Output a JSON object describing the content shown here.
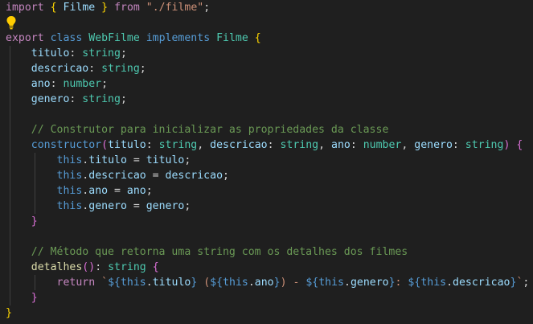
{
  "theme": {
    "background": "#1f1f1f",
    "colors": {
      "kw": "#c586c0",
      "st": "#569cd6",
      "cls": "#4ec9b0",
      "var": "#9cdcfe",
      "fn": "#dcdcaa",
      "str": "#ce9178",
      "cmt": "#6a9955",
      "pun": "#d4d4d4",
      "br1": "#ffd700",
      "br2": "#da70d6",
      "br3": "#179fff"
    }
  },
  "editor": {
    "lightbulb_icon": "lightbulb-icon",
    "lines": [
      [
        [
          "import",
          "kw"
        ],
        [
          " ",
          "pun"
        ],
        [
          "{",
          "br1"
        ],
        [
          " ",
          "pun"
        ],
        [
          "Filme",
          "var"
        ],
        [
          " ",
          "pun"
        ],
        [
          "}",
          "br1"
        ],
        [
          " ",
          "pun"
        ],
        [
          "from",
          "kw"
        ],
        [
          " ",
          "pun"
        ],
        [
          "\"./filme\"",
          "str"
        ],
        [
          ";",
          "pun"
        ]
      ],
      [],
      [
        [
          "export",
          "kw"
        ],
        [
          " ",
          "pun"
        ],
        [
          "class",
          "st"
        ],
        [
          " ",
          "pun"
        ],
        [
          "WebFilme",
          "cls"
        ],
        [
          " ",
          "pun"
        ],
        [
          "implements",
          "st"
        ],
        [
          " ",
          "pun"
        ],
        [
          "Filme",
          "cls"
        ],
        [
          " ",
          "pun"
        ],
        [
          "{",
          "br1"
        ]
      ],
      [
        [
          "    ",
          "pun"
        ],
        [
          "titulo",
          "var"
        ],
        [
          ": ",
          "pun"
        ],
        [
          "string",
          "cls"
        ],
        [
          ";",
          "pun"
        ]
      ],
      [
        [
          "    ",
          "pun"
        ],
        [
          "descricao",
          "var"
        ],
        [
          ": ",
          "pun"
        ],
        [
          "string",
          "cls"
        ],
        [
          ";",
          "pun"
        ]
      ],
      [
        [
          "    ",
          "pun"
        ],
        [
          "ano",
          "var"
        ],
        [
          ": ",
          "pun"
        ],
        [
          "number",
          "cls"
        ],
        [
          ";",
          "pun"
        ]
      ],
      [
        [
          "    ",
          "pun"
        ],
        [
          "genero",
          "var"
        ],
        [
          ": ",
          "pun"
        ],
        [
          "string",
          "cls"
        ],
        [
          ";",
          "pun"
        ]
      ],
      [],
      [
        [
          "    ",
          "pun"
        ],
        [
          "// Construtor para inicializar as propriedades da classe",
          "cmt"
        ]
      ],
      [
        [
          "    ",
          "pun"
        ],
        [
          "constructor",
          "st"
        ],
        [
          "(",
          "br2"
        ],
        [
          "titulo",
          "var"
        ],
        [
          ": ",
          "pun"
        ],
        [
          "string",
          "cls"
        ],
        [
          ", ",
          "pun"
        ],
        [
          "descricao",
          "var"
        ],
        [
          ": ",
          "pun"
        ],
        [
          "string",
          "cls"
        ],
        [
          ", ",
          "pun"
        ],
        [
          "ano",
          "var"
        ],
        [
          ": ",
          "pun"
        ],
        [
          "number",
          "cls"
        ],
        [
          ", ",
          "pun"
        ],
        [
          "genero",
          "var"
        ],
        [
          ": ",
          "pun"
        ],
        [
          "string",
          "cls"
        ],
        [
          ")",
          "br2"
        ],
        [
          " ",
          "pun"
        ],
        [
          "{",
          "br2"
        ]
      ],
      [
        [
          "        ",
          "pun"
        ],
        [
          "this",
          "st"
        ],
        [
          ".",
          "pun"
        ],
        [
          "titulo",
          "var"
        ],
        [
          " = ",
          "pun"
        ],
        [
          "titulo",
          "var"
        ],
        [
          ";",
          "pun"
        ]
      ],
      [
        [
          "        ",
          "pun"
        ],
        [
          "this",
          "st"
        ],
        [
          ".",
          "pun"
        ],
        [
          "descricao",
          "var"
        ],
        [
          " = ",
          "pun"
        ],
        [
          "descricao",
          "var"
        ],
        [
          ";",
          "pun"
        ]
      ],
      [
        [
          "        ",
          "pun"
        ],
        [
          "this",
          "st"
        ],
        [
          ".",
          "pun"
        ],
        [
          "ano",
          "var"
        ],
        [
          " = ",
          "pun"
        ],
        [
          "ano",
          "var"
        ],
        [
          ";",
          "pun"
        ]
      ],
      [
        [
          "        ",
          "pun"
        ],
        [
          "this",
          "st"
        ],
        [
          ".",
          "pun"
        ],
        [
          "genero",
          "var"
        ],
        [
          " = ",
          "pun"
        ],
        [
          "genero",
          "var"
        ],
        [
          ";",
          "pun"
        ]
      ],
      [
        [
          "    ",
          "pun"
        ],
        [
          "}",
          "br2"
        ]
      ],
      [],
      [
        [
          "    ",
          "pun"
        ],
        [
          "// Método que retorna uma string com os detalhes dos filmes",
          "cmt"
        ]
      ],
      [
        [
          "    ",
          "pun"
        ],
        [
          "detalhes",
          "fn"
        ],
        [
          "(",
          "br2"
        ],
        [
          ")",
          "br2"
        ],
        [
          ": ",
          "pun"
        ],
        [
          "string",
          "cls"
        ],
        [
          " ",
          "pun"
        ],
        [
          "{",
          "br2"
        ]
      ],
      [
        [
          "        ",
          "pun"
        ],
        [
          "return",
          "kw"
        ],
        [
          " ",
          "pun"
        ],
        [
          "`",
          "str"
        ],
        [
          "${",
          "st"
        ],
        [
          "this",
          "st"
        ],
        [
          ".",
          "pun"
        ],
        [
          "titulo",
          "var"
        ],
        [
          "}",
          "st"
        ],
        [
          " (",
          "str"
        ],
        [
          "${",
          "st"
        ],
        [
          "this",
          "st"
        ],
        [
          ".",
          "pun"
        ],
        [
          "ano",
          "var"
        ],
        [
          "}",
          "st"
        ],
        [
          ") - ",
          "str"
        ],
        [
          "${",
          "st"
        ],
        [
          "this",
          "st"
        ],
        [
          ".",
          "pun"
        ],
        [
          "genero",
          "var"
        ],
        [
          "}",
          "st"
        ],
        [
          ": ",
          "str"
        ],
        [
          "${",
          "st"
        ],
        [
          "this",
          "st"
        ],
        [
          ".",
          "pun"
        ],
        [
          "descricao",
          "var"
        ],
        [
          "}",
          "st"
        ],
        [
          "`",
          "str"
        ],
        [
          ";",
          "pun"
        ]
      ],
      [
        [
          "    ",
          "pun"
        ],
        [
          "}",
          "br2"
        ]
      ],
      [
        [
          "}",
          "br1"
        ]
      ]
    ]
  }
}
